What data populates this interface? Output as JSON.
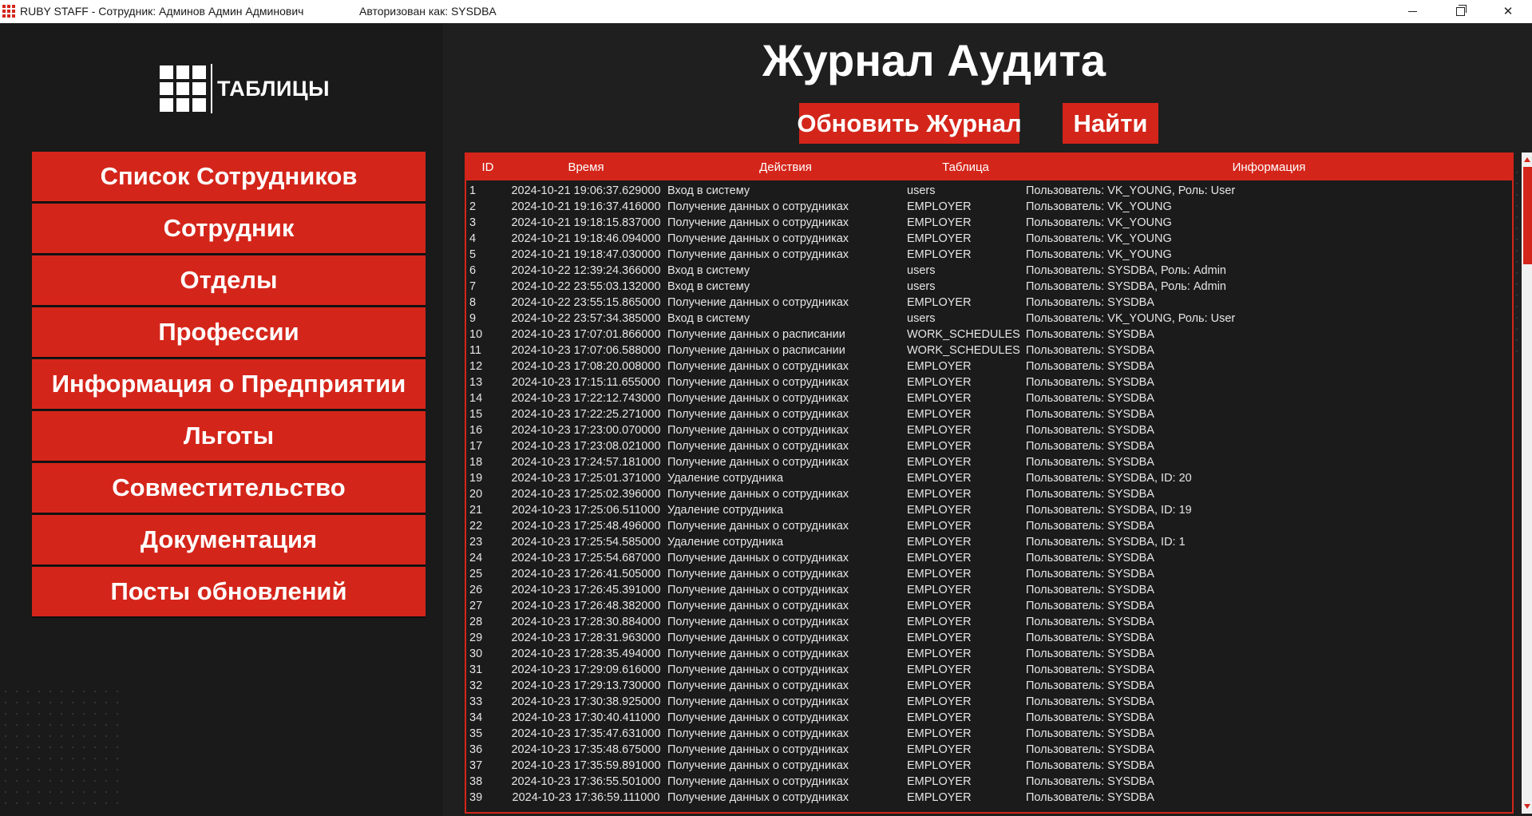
{
  "titlebar": {
    "title": "RUBY STAFF - Сотрудник: Админов Админ Админович",
    "auth": "Авторизован как: SYSDBA"
  },
  "logo": {
    "text": "ТАБЛИЦЫ"
  },
  "nav": [
    {
      "label": "Список Сотрудников"
    },
    {
      "label": "Сотрудник"
    },
    {
      "label": "Отделы"
    },
    {
      "label": "Профессии"
    },
    {
      "label": "Информация о Предприятии"
    },
    {
      "label": "Льготы"
    },
    {
      "label": "Совместительство"
    },
    {
      "label": "Документация"
    },
    {
      "label": "Посты обновлений"
    }
  ],
  "page": {
    "title": "Журнал Аудита",
    "refresh_label": "Обновить Журнал",
    "find_label": "Найти"
  },
  "table": {
    "columns": [
      "ID",
      "Время",
      "Действия",
      "Таблица",
      "Информация"
    ],
    "rows": [
      [
        "1",
        "2024-10-21 19:06:37.629000",
        "Вход в систему",
        "users",
        "Пользователь: VK_YOUNG, Роль: User"
      ],
      [
        "2",
        "2024-10-21 19:16:37.416000",
        "Получение данных о сотрудниках",
        "EMPLOYER",
        "Пользователь: VK_YOUNG"
      ],
      [
        "3",
        "2024-10-21 19:18:15.837000",
        "Получение данных о сотрудниках",
        "EMPLOYER",
        "Пользователь: VK_YOUNG"
      ],
      [
        "4",
        "2024-10-21 19:18:46.094000",
        "Получение данных о сотрудниках",
        "EMPLOYER",
        "Пользователь: VK_YOUNG"
      ],
      [
        "5",
        "2024-10-21 19:18:47.030000",
        "Получение данных о сотрудниках",
        "EMPLOYER",
        "Пользователь: VK_YOUNG"
      ],
      [
        "6",
        "2024-10-22 12:39:24.366000",
        "Вход в систему",
        "users",
        "Пользователь: SYSDBA, Роль: Admin"
      ],
      [
        "7",
        "2024-10-22 23:55:03.132000",
        "Вход в систему",
        "users",
        "Пользователь: SYSDBA, Роль: Admin"
      ],
      [
        "8",
        "2024-10-22 23:55:15.865000",
        "Получение данных о сотрудниках",
        "EMPLOYER",
        "Пользователь: SYSDBA"
      ],
      [
        "9",
        "2024-10-22 23:57:34.385000",
        "Вход в систему",
        "users",
        "Пользователь: VK_YOUNG, Роль: User"
      ],
      [
        "10",
        "2024-10-23 17:07:01.866000",
        "Получение данных о расписании",
        "WORK_SCHEDULES",
        "Пользователь: SYSDBA"
      ],
      [
        "11",
        "2024-10-23 17:07:06.588000",
        "Получение данных о расписании",
        "WORK_SCHEDULES",
        "Пользователь: SYSDBA"
      ],
      [
        "12",
        "2024-10-23 17:08:20.008000",
        "Получение данных о сотрудниках",
        "EMPLOYER",
        "Пользователь: SYSDBA"
      ],
      [
        "13",
        "2024-10-23 17:15:11.655000",
        "Получение данных о сотрудниках",
        "EMPLOYER",
        "Пользователь: SYSDBA"
      ],
      [
        "14",
        "2024-10-23 17:22:12.743000",
        "Получение данных о сотрудниках",
        "EMPLOYER",
        "Пользователь: SYSDBA"
      ],
      [
        "15",
        "2024-10-23 17:22:25.271000",
        "Получение данных о сотрудниках",
        "EMPLOYER",
        "Пользователь: SYSDBA"
      ],
      [
        "16",
        "2024-10-23 17:23:00.070000",
        "Получение данных о сотрудниках",
        "EMPLOYER",
        "Пользователь: SYSDBA"
      ],
      [
        "17",
        "2024-10-23 17:23:08.021000",
        "Получение данных о сотрудниках",
        "EMPLOYER",
        "Пользователь: SYSDBA"
      ],
      [
        "18",
        "2024-10-23 17:24:57.181000",
        "Получение данных о сотрудниках",
        "EMPLOYER",
        "Пользователь: SYSDBA"
      ],
      [
        "19",
        "2024-10-23 17:25:01.371000",
        "Удаление сотрудника",
        "EMPLOYER",
        "Пользователь: SYSDBA, ID: 20"
      ],
      [
        "20",
        "2024-10-23 17:25:02.396000",
        "Получение данных о сотрудниках",
        "EMPLOYER",
        "Пользователь: SYSDBA"
      ],
      [
        "21",
        "2024-10-23 17:25:06.511000",
        "Удаление сотрудника",
        "EMPLOYER",
        "Пользователь: SYSDBA, ID: 19"
      ],
      [
        "22",
        "2024-10-23 17:25:48.496000",
        "Получение данных о сотрудниках",
        "EMPLOYER",
        "Пользователь: SYSDBA"
      ],
      [
        "23",
        "2024-10-23 17:25:54.585000",
        "Удаление сотрудника",
        "EMPLOYER",
        "Пользователь: SYSDBA, ID: 1"
      ],
      [
        "24",
        "2024-10-23 17:25:54.687000",
        "Получение данных о сотрудниках",
        "EMPLOYER",
        "Пользователь: SYSDBA"
      ],
      [
        "25",
        "2024-10-23 17:26:41.505000",
        "Получение данных о сотрудниках",
        "EMPLOYER",
        "Пользователь: SYSDBA"
      ],
      [
        "26",
        "2024-10-23 17:26:45.391000",
        "Получение данных о сотрудниках",
        "EMPLOYER",
        "Пользователь: SYSDBA"
      ],
      [
        "27",
        "2024-10-23 17:26:48.382000",
        "Получение данных о сотрудниках",
        "EMPLOYER",
        "Пользователь: SYSDBA"
      ],
      [
        "28",
        "2024-10-23 17:28:30.884000",
        "Получение данных о сотрудниках",
        "EMPLOYER",
        "Пользователь: SYSDBA"
      ],
      [
        "29",
        "2024-10-23 17:28:31.963000",
        "Получение данных о сотрудниках",
        "EMPLOYER",
        "Пользователь: SYSDBA"
      ],
      [
        "30",
        "2024-10-23 17:28:35.494000",
        "Получение данных о сотрудниках",
        "EMPLOYER",
        "Пользователь: SYSDBA"
      ],
      [
        "31",
        "2024-10-23 17:29:09.616000",
        "Получение данных о сотрудниках",
        "EMPLOYER",
        "Пользователь: SYSDBA"
      ],
      [
        "32",
        "2024-10-23 17:29:13.730000",
        "Получение данных о сотрудниках",
        "EMPLOYER",
        "Пользователь: SYSDBA"
      ],
      [
        "33",
        "2024-10-23 17:30:38.925000",
        "Получение данных о сотрудниках",
        "EMPLOYER",
        "Пользователь: SYSDBA"
      ],
      [
        "34",
        "2024-10-23 17:30:40.411000",
        "Получение данных о сотрудниках",
        "EMPLOYER",
        "Пользователь: SYSDBA"
      ],
      [
        "35",
        "2024-10-23 17:35:47.631000",
        "Получение данных о сотрудниках",
        "EMPLOYER",
        "Пользователь: SYSDBA"
      ],
      [
        "36",
        "2024-10-23 17:35:48.675000",
        "Получение данных о сотрудниках",
        "EMPLOYER",
        "Пользователь: SYSDBA"
      ],
      [
        "37",
        "2024-10-23 17:35:59.891000",
        "Получение данных о сотрудниках",
        "EMPLOYER",
        "Пользователь: SYSDBA"
      ],
      [
        "38",
        "2024-10-23 17:36:55.501000",
        "Получение данных о сотрудниках",
        "EMPLOYER",
        "Пользователь: SYSDBA"
      ],
      [
        "39",
        "2024-10-23 17:36:59.111000",
        "Получение данных о сотрудниках",
        "EMPLOYER",
        "Пользователь: SYSDBA"
      ]
    ]
  },
  "colors": {
    "accent": "#d4251a",
    "background": "#1d1d1d",
    "text": "#ffffff"
  },
  "icons": {
    "app": "grid-icon",
    "logo": "table-grid-icon",
    "minimize": "minimize-icon",
    "maximize": "restore-icon",
    "close": "close-icon"
  }
}
